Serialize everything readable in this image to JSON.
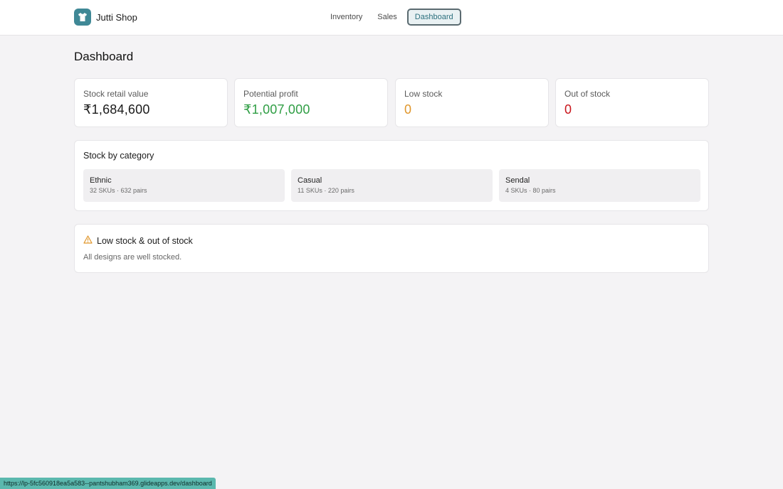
{
  "app": {
    "name": "Jutti Shop",
    "logo_icon": "tshirt-icon"
  },
  "nav": {
    "items": [
      {
        "label": "Inventory",
        "active": false
      },
      {
        "label": "Sales",
        "active": false
      },
      {
        "label": "Dashboard",
        "active": true
      }
    ]
  },
  "page": {
    "title": "Dashboard"
  },
  "stats": [
    {
      "label": "Stock retail value",
      "value": "₹1,684,600",
      "color": "#1a1a1a"
    },
    {
      "label": "Potential profit",
      "value": "₹1,007,000",
      "color": "#2f9e44"
    },
    {
      "label": "Low stock",
      "value": "0",
      "color": "#e0962b"
    },
    {
      "label": "Out of stock",
      "value": "0",
      "color": "#c9151b"
    }
  ],
  "categories": {
    "title": "Stock by category",
    "items": [
      {
        "name": "Ethnic",
        "meta": "32 SKUs · 632 pairs"
      },
      {
        "name": "Casual",
        "meta": "11 SKUs · 220 pairs"
      },
      {
        "name": "Sendal",
        "meta": "4 SKUs · 80 pairs"
      }
    ]
  },
  "alerts": {
    "title": "Low stock & out of stock",
    "icon": "warning-icon",
    "icon_color": "#e0962b",
    "message": "All designs are well stocked."
  },
  "status_url": "https://lp-5fc560918ea5a583--pantshubham369.glideapps.dev/dashboard"
}
